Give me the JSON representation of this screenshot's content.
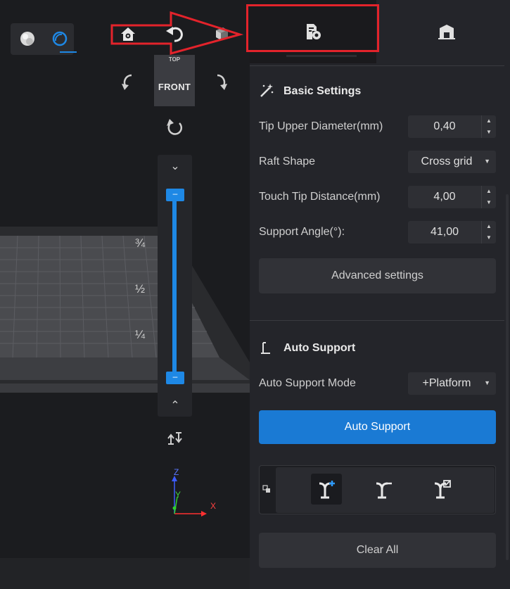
{
  "viewport": {
    "cube_top_label": "TOP",
    "cube_front_label": "FRONT",
    "layer_marks": [
      "¾",
      "½",
      "¼"
    ],
    "axes": {
      "z": "Z",
      "y": "Y",
      "x": "X"
    }
  },
  "panel": {
    "basic_settings": {
      "title": "Basic Settings",
      "fields": [
        {
          "label": "Tip Upper Diameter(mm)",
          "value": "0,40"
        },
        {
          "label": "Raft Shape",
          "value": "Cross grid"
        },
        {
          "label": "Touch Tip Distance(mm)",
          "value": "4,00"
        },
        {
          "label": "Support Angle(°):",
          "value": "41,00"
        }
      ],
      "advanced_button": "Advanced settings"
    },
    "auto_support": {
      "title": "Auto Support",
      "mode_label": "Auto Support Mode",
      "mode_value": "+Platform",
      "run_button": "Auto Support",
      "clear_button": "Clear All"
    }
  },
  "colors": {
    "accent": "#1e88e5",
    "annotation": "#e3232b"
  }
}
